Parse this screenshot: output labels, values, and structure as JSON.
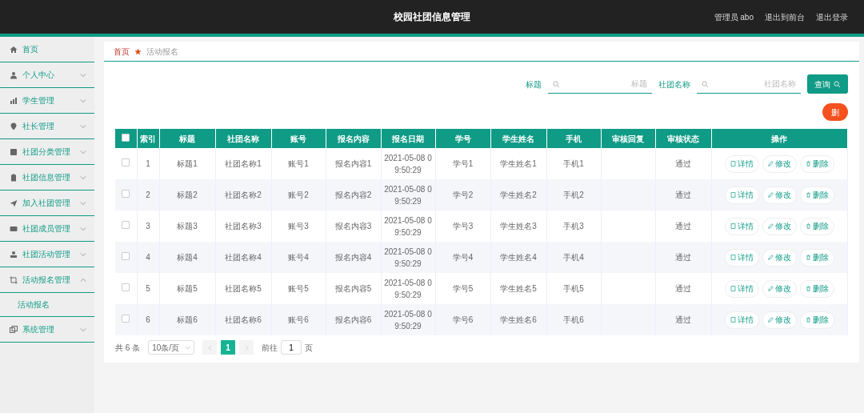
{
  "header": {
    "title": "校园社团信息管理",
    "links": [
      "管理员 abo",
      "退出到前台",
      "退出登录"
    ]
  },
  "sidebar": {
    "items": [
      {
        "label": "首页"
      },
      {
        "label": "个人中心",
        "expanded": false
      },
      {
        "label": "学生管理",
        "expanded": false
      },
      {
        "label": "社长管理",
        "expanded": false
      },
      {
        "label": "社团分类管理",
        "expanded": false
      },
      {
        "label": "社团信息管理",
        "expanded": false
      },
      {
        "label": "加入社团管理",
        "expanded": false
      },
      {
        "label": "社团成员管理",
        "expanded": false
      },
      {
        "label": "社团活动管理",
        "expanded": false
      },
      {
        "label": "活动报名管理",
        "expanded": true,
        "children": [
          {
            "label": "活动报名"
          }
        ]
      },
      {
        "label": "系统管理",
        "expanded": false
      }
    ]
  },
  "breadcrumb": [
    "首页",
    "活动报名"
  ],
  "search": {
    "fields": [
      {
        "label": "标题",
        "placeholder": "标题"
      },
      {
        "label": "社团名称",
        "placeholder": "社团名称"
      }
    ],
    "button": "查询"
  },
  "delete_button": "删",
  "table": {
    "header_checked": false,
    "columns": [
      "索引",
      "标题",
      "社团名称",
      "账号",
      "报名内容",
      "报名日期",
      "学号",
      "学生姓名",
      "手机",
      "审核回复",
      "审核状态",
      "操作"
    ],
    "rows": [
      {
        "checked": false,
        "cells": [
          "1",
          "标题1",
          "社团名称1",
          "账号1",
          "报名内容1",
          "2021-05-08 0\n9:50:29",
          "学号1",
          "学生姓名1",
          "手机1",
          "",
          "通过"
        ]
      },
      {
        "checked": false,
        "cells": [
          "2",
          "标题2",
          "社团名称2",
          "账号2",
          "报名内容2",
          "2021-05-08 0\n9:50:29",
          "学号2",
          "学生姓名2",
          "手机2",
          "",
          "通过"
        ]
      },
      {
        "checked": false,
        "cells": [
          "3",
          "标题3",
          "社团名称3",
          "账号3",
          "报名内容3",
          "2021-05-08 0\n9:50:29",
          "学号3",
          "学生姓名3",
          "手机3",
          "",
          "通过"
        ]
      },
      {
        "checked": false,
        "cells": [
          "4",
          "标题4",
          "社团名称4",
          "账号4",
          "报名内容4",
          "2021-05-08 0\n9:50:29",
          "学号4",
          "学生姓名4",
          "手机4",
          "",
          "通过"
        ]
      },
      {
        "checked": false,
        "cells": [
          "5",
          "标题5",
          "社团名称5",
          "账号5",
          "报名内容5",
          "2021-05-08 0\n9:50:29",
          "学号5",
          "学生姓名5",
          "手机5",
          "",
          "通过"
        ]
      },
      {
        "checked": false,
        "cells": [
          "6",
          "标题6",
          "社团名称6",
          "账号6",
          "报名内容6",
          "2021-05-08 0\n9:50:29",
          "学号6",
          "学生姓名6",
          "手机6",
          "",
          "通过"
        ]
      }
    ],
    "actions": [
      [
        "详情",
        "修改",
        "删除"
      ],
      [
        "详情",
        "修改",
        "删除"
      ],
      [
        "详情",
        "修改",
        "删除"
      ],
      [
        "详情",
        "修改",
        "删除"
      ],
      [
        "详情",
        "修改",
        "删除"
      ],
      [
        "详情",
        "修改",
        "删除"
      ]
    ]
  },
  "pagination": {
    "total": "共 6 条",
    "page_size": "10条/页",
    "pages": [
      {
        "label": "1",
        "selected": true
      }
    ],
    "goto_label": "前往",
    "goto_value": "1",
    "goto_suffix": "页"
  }
}
